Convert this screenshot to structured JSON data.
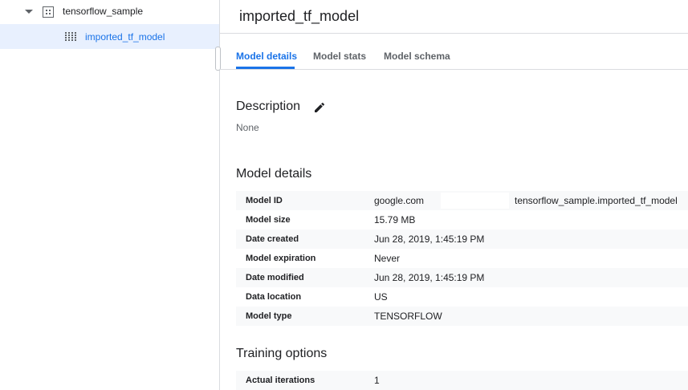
{
  "explorer": {
    "dataset_label": "tensorflow_sample",
    "model_label": "imported_tf_model"
  },
  "page": {
    "title": "imported_tf_model"
  },
  "tabs": [
    {
      "label": "Model details",
      "active": true
    },
    {
      "label": "Model stats",
      "active": false
    },
    {
      "label": "Model schema",
      "active": false
    }
  ],
  "description": {
    "heading": "Description",
    "value": "None"
  },
  "model_details": {
    "heading": "Model details",
    "rows": [
      {
        "key": "Model ID",
        "value": "google.com",
        "value2": "tensorflow_sample.imported_tf_model"
      },
      {
        "key": "Model size",
        "value": "15.79 MB"
      },
      {
        "key": "Date created",
        "value": "Jun 28, 2019, 1:45:19 PM"
      },
      {
        "key": "Model expiration",
        "value": "Never"
      },
      {
        "key": "Date modified",
        "value": "Jun 28, 2019, 1:45:19 PM"
      },
      {
        "key": "Data location",
        "value": "US"
      },
      {
        "key": "Model type",
        "value": "TENSORFLOW"
      }
    ]
  },
  "training_options": {
    "heading": "Training options",
    "rows": [
      {
        "key": "Actual iterations",
        "value": "1"
      }
    ]
  },
  "icons": {
    "expand": "caret-down-icon",
    "dataset": "dataset-icon",
    "model": "model-icon",
    "edit": "pencil-icon"
  },
  "colors": {
    "accent": "#1a73e8",
    "selected_bg": "#e8f0fe",
    "row_shade": "#f8f9fa"
  }
}
